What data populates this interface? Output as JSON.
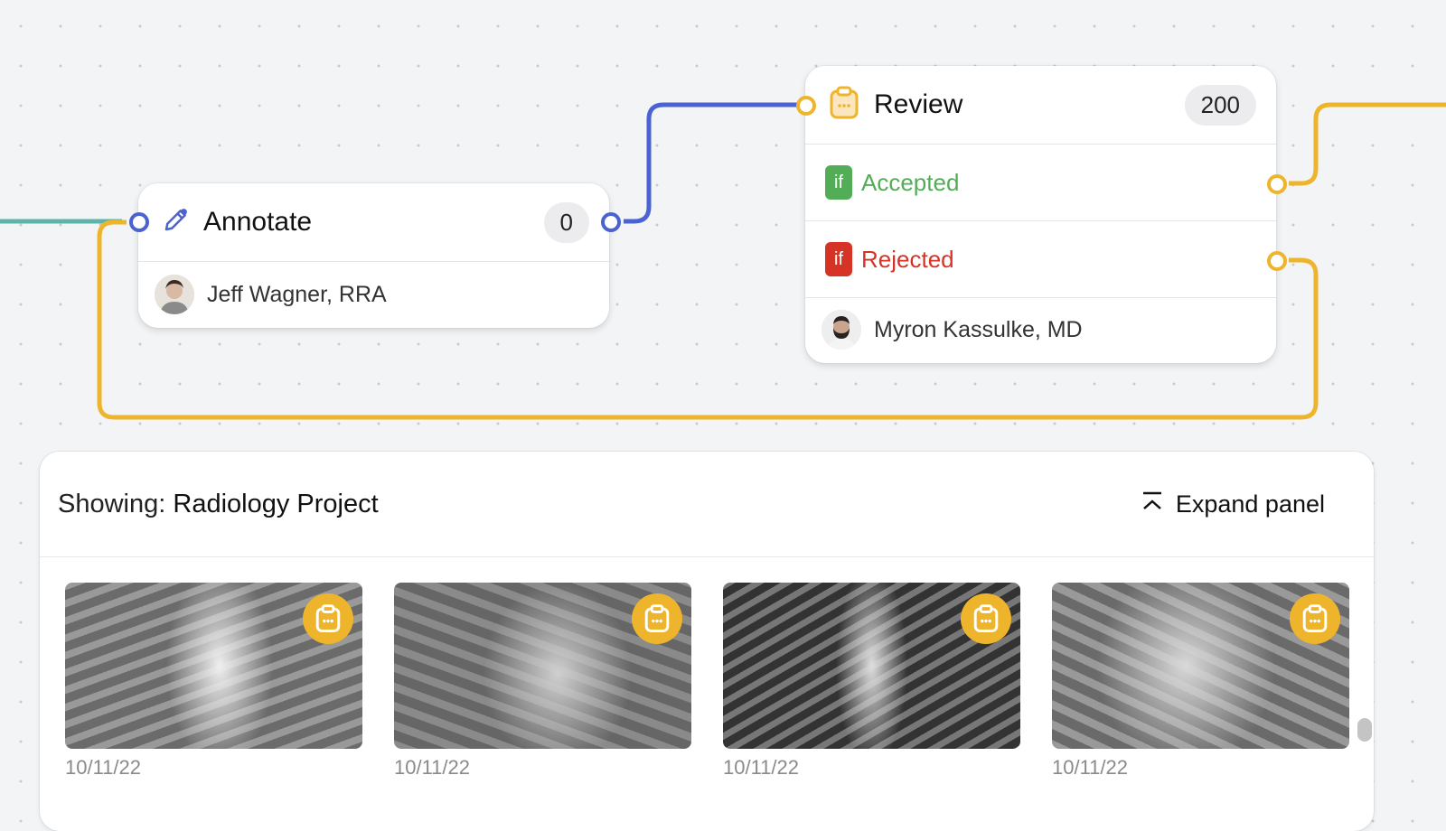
{
  "colors": {
    "teal": "#5fb3a8",
    "blue": "#4a63d0",
    "yellow": "#eeb52c",
    "green": "#53ad57",
    "red": "#d63326"
  },
  "nodes": {
    "annotate": {
      "title": "Annotate",
      "count": "0",
      "icon": "pencil-icon",
      "assignee": "Jeff Wagner, RRA"
    },
    "review": {
      "title": "Review",
      "count": "200",
      "icon": "clipboard-icon",
      "conditions": [
        {
          "tag": "if",
          "label": "Accepted",
          "status": "accepted"
        },
        {
          "tag": "if",
          "label": "Rejected",
          "status": "rejected"
        }
      ],
      "assignee": "Myron Kassulke, MD"
    }
  },
  "panel": {
    "showing_label": "Showing:",
    "project": "Radiology Project",
    "expand_label": "Expand panel",
    "items": [
      {
        "date": "10/11/22",
        "badge": "clipboard-icon"
      },
      {
        "date": "10/11/22",
        "badge": "clipboard-icon"
      },
      {
        "date": "10/11/22",
        "badge": "clipboard-icon"
      },
      {
        "date": "10/11/22",
        "badge": "clipboard-icon"
      }
    ]
  }
}
